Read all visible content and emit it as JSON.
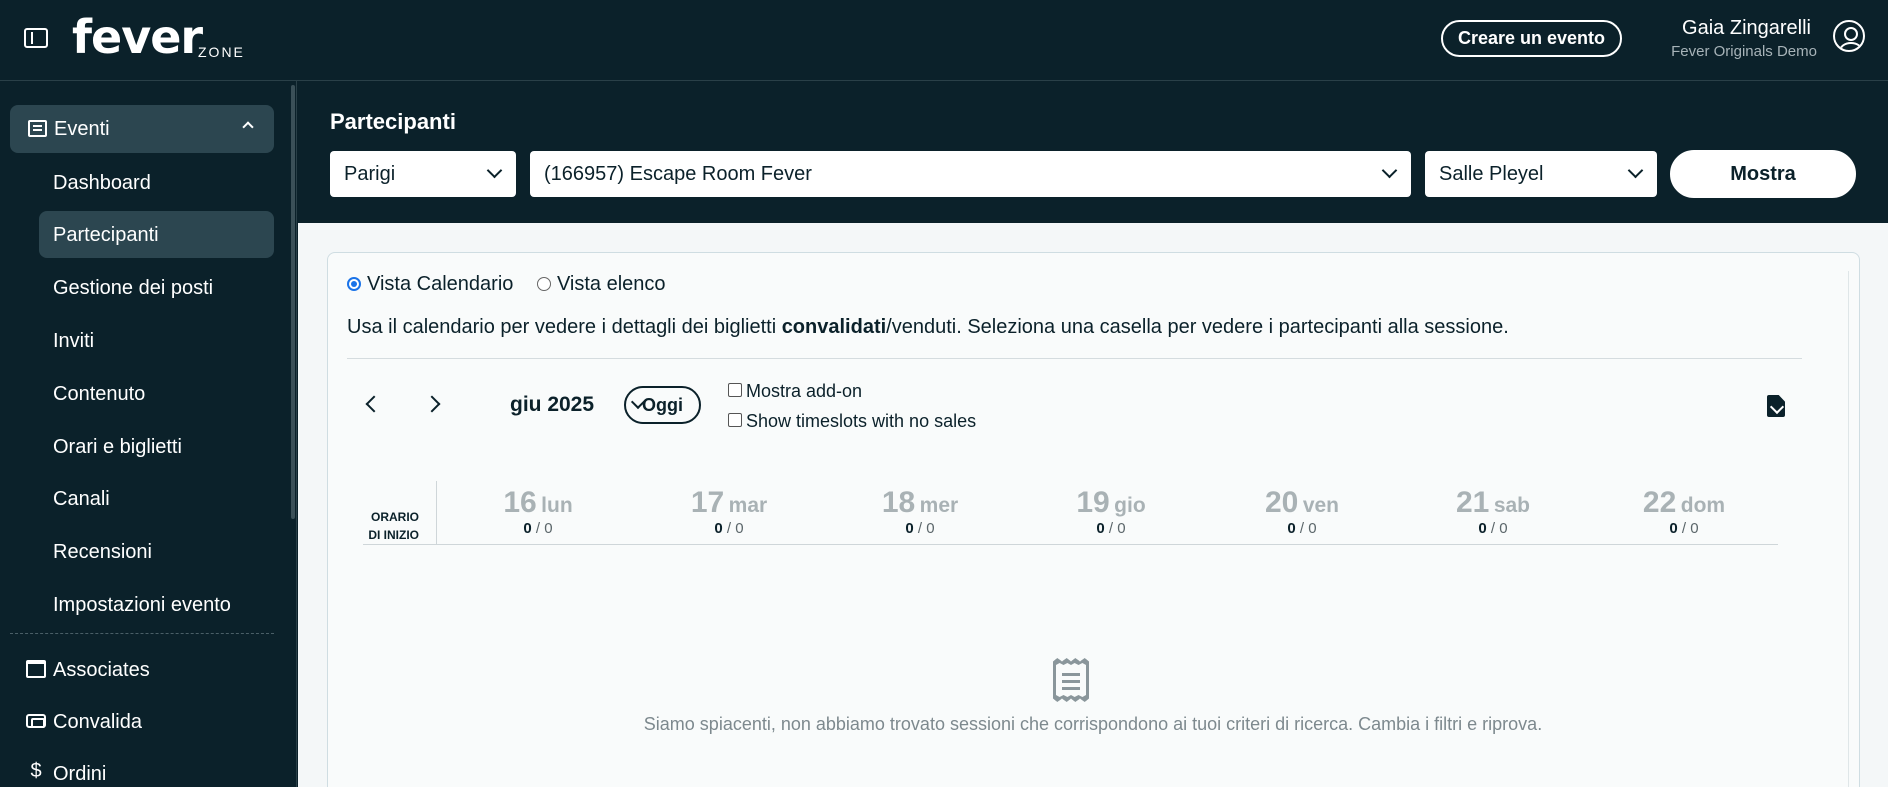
{
  "topbar": {
    "logo": "fever",
    "logo_suffix": "ZONE",
    "create_event_label": "Creare un evento",
    "user_name": "Gaia Zingarelli",
    "user_org": "Fever Originals Demo"
  },
  "sidebar": {
    "section": {
      "label": "Eventi",
      "icon": "list-icon",
      "expanded": true
    },
    "sub_items": [
      {
        "label": "Dashboard",
        "active": false
      },
      {
        "label": "Partecipanti",
        "active": true
      },
      {
        "label": "Gestione dei posti",
        "active": false
      },
      {
        "label": "Inviti",
        "active": false
      },
      {
        "label": "Contenuto",
        "active": false
      },
      {
        "label": "Orari e biglietti",
        "active": false
      },
      {
        "label": "Canali",
        "active": false
      },
      {
        "label": "Recensioni",
        "active": false
      },
      {
        "label": "Impostazioni evento",
        "active": false
      }
    ],
    "main_items": [
      {
        "label": "Associates",
        "icon": "store-icon"
      },
      {
        "label": "Convalida",
        "icon": "ticket-icon"
      },
      {
        "label": "Ordini",
        "icon": "dollar-icon"
      }
    ]
  },
  "filters": {
    "title": "Partecipanti",
    "city": "Parigi",
    "event": "(166957) Escape Room Fever",
    "venue": "Salle Pleyel",
    "show_label": "Mostra"
  },
  "view": {
    "calendar_label": "Vista Calendario",
    "list_label": "Vista elenco",
    "selected": "calendar",
    "desc_pre": "Usa il calendario per vedere i dettagli dei biglietti ",
    "desc_bold": "convalidati",
    "desc_post": "/venduti. Seleziona una casella per vedere i partecipanti alla sessione."
  },
  "calendar": {
    "month_label": "giu 2025",
    "today_label": "Oggi",
    "show_addons_label": "Mostra add-on",
    "show_no_sales_label": "Show timeslots with no sales",
    "time_header": [
      "ORARIO",
      "DI INIZIO"
    ],
    "days": [
      {
        "num": "16",
        "weekday": "lun",
        "validated": "0",
        "sold": "/ 0"
      },
      {
        "num": "17",
        "weekday": "mar",
        "validated": "0",
        "sold": "/ 0"
      },
      {
        "num": "18",
        "weekday": "mer",
        "validated": "0",
        "sold": "/ 0"
      },
      {
        "num": "19",
        "weekday": "gio",
        "validated": "0",
        "sold": "/ 0"
      },
      {
        "num": "20",
        "weekday": "ven",
        "validated": "0",
        "sold": "/ 0"
      },
      {
        "num": "21",
        "weekday": "sab",
        "validated": "0",
        "sold": "/ 0"
      },
      {
        "num": "22",
        "weekday": "dom",
        "validated": "0",
        "sold": "/ 0"
      }
    ],
    "empty_message": "Siamo spiacenti, non abbiamo trovato sessioni che corrispondono ai tuoi criteri di ricerca. Cambia i filtri e riprova."
  },
  "colors": {
    "brand_dark": "#0b212a",
    "active_nav": "#2c4650",
    "radio_accent": "#1a73e8"
  }
}
